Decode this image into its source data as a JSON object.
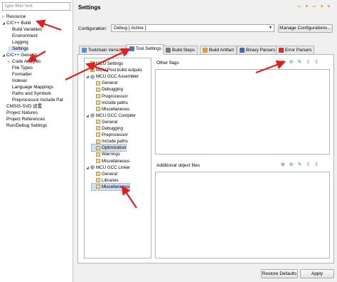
{
  "left": {
    "filter_placeholder": "type filter text",
    "items": [
      {
        "label": "Resource",
        "expander": "▷"
      },
      {
        "label": "C/C++ Build",
        "expander": "◢"
      },
      {
        "label": "Build Variables",
        "expander": ""
      },
      {
        "label": "Environment",
        "expander": ""
      },
      {
        "label": "Logging",
        "expander": ""
      },
      {
        "label": "Settings",
        "expander": ""
      },
      {
        "label": "C/C++ General",
        "expander": "◢"
      },
      {
        "label": "Code Analysis",
        "expander": "▷"
      },
      {
        "label": "File Types",
        "expander": ""
      },
      {
        "label": "Formatter",
        "expander": ""
      },
      {
        "label": "Indexer",
        "expander": ""
      },
      {
        "label": "Language Mappings",
        "expander": ""
      },
      {
        "label": "Paths and Symbols",
        "expander": ""
      },
      {
        "label": "Preprocessor Include Pat",
        "expander": ""
      },
      {
        "label": "CMSIS-SVD 设置",
        "expander": ""
      },
      {
        "label": "Project Natures",
        "expander": ""
      },
      {
        "label": "Project References",
        "expander": ""
      },
      {
        "label": "Run/Debug Settings",
        "expander": ""
      }
    ]
  },
  "header": {
    "title": "Settings",
    "nav_icons": "⇦ ▾ ⇨ ▾ ▾"
  },
  "config": {
    "label": "Configuration:",
    "value": "Debug  [ Active ]",
    "arrow": "▼",
    "manage_label": "Manage Configurations..."
  },
  "tabs": [
    {
      "label": "Toolchain Version",
      "color": "#5b8fd6"
    },
    {
      "label": "Tool Settings",
      "color": "#4a7bc0"
    },
    {
      "label": "Build Steps",
      "color": "#777777"
    },
    {
      "label": "Build Artifact",
      "color": "#e0a020"
    },
    {
      "label": "Binary Parsers",
      "color": "#3a6fb8"
    },
    {
      "label": "Error Parsers",
      "color": "#d03030"
    }
  ],
  "tool_tree": [
    {
      "label": "MCU Settings",
      "expander": "",
      "icon": "sq"
    },
    {
      "label": "MCU Post build outputs",
      "expander": "",
      "icon": "sq"
    },
    {
      "label": "MCU GCC Assembler",
      "expander": "◢",
      "icon": "gear"
    },
    {
      "label": "General",
      "expander": "",
      "icon": "sq"
    },
    {
      "label": "Debugging",
      "expander": "",
      "icon": "sq"
    },
    {
      "label": "Preprocessor",
      "expander": "",
      "icon": "sq"
    },
    {
      "label": "Include paths",
      "expander": "",
      "icon": "sq"
    },
    {
      "label": "Miscellaneous",
      "expander": "",
      "icon": "sq"
    },
    {
      "label": "MCU GCC Compiler",
      "expander": "◢",
      "icon": "gear"
    },
    {
      "label": "General",
      "expander": "",
      "icon": "sq"
    },
    {
      "label": "Debugging",
      "expander": "",
      "icon": "sq"
    },
    {
      "label": "Preprocessor",
      "expander": "",
      "icon": "sq"
    },
    {
      "label": "Include paths",
      "expander": "",
      "icon": "sq"
    },
    {
      "label": "Optimization",
      "expander": "",
      "icon": "sq"
    },
    {
      "label": "Warnings",
      "expander": "",
      "icon": "sq"
    },
    {
      "label": "Miscellaneous",
      "expander": "",
      "icon": "sq"
    },
    {
      "label": "MCU GCC Linker",
      "expander": "◢",
      "icon": "gear"
    },
    {
      "label": "General",
      "expander": "",
      "icon": "sq"
    },
    {
      "label": "Libraries",
      "expander": "",
      "icon": "sq"
    },
    {
      "label": "Miscellaneous",
      "expander": "",
      "icon": "sq"
    }
  ],
  "panels": {
    "other_flags": "Other flags",
    "additional_files": "Additional object files",
    "toolbar_icons": "⊕ ⊖ ✎ ⇧ ⇩"
  },
  "buttons": {
    "restore": "Restore Defaults",
    "apply": "Apply"
  },
  "colors": {
    "annotation_arrow": "#e02020",
    "selection": "#cfe0f5"
  }
}
